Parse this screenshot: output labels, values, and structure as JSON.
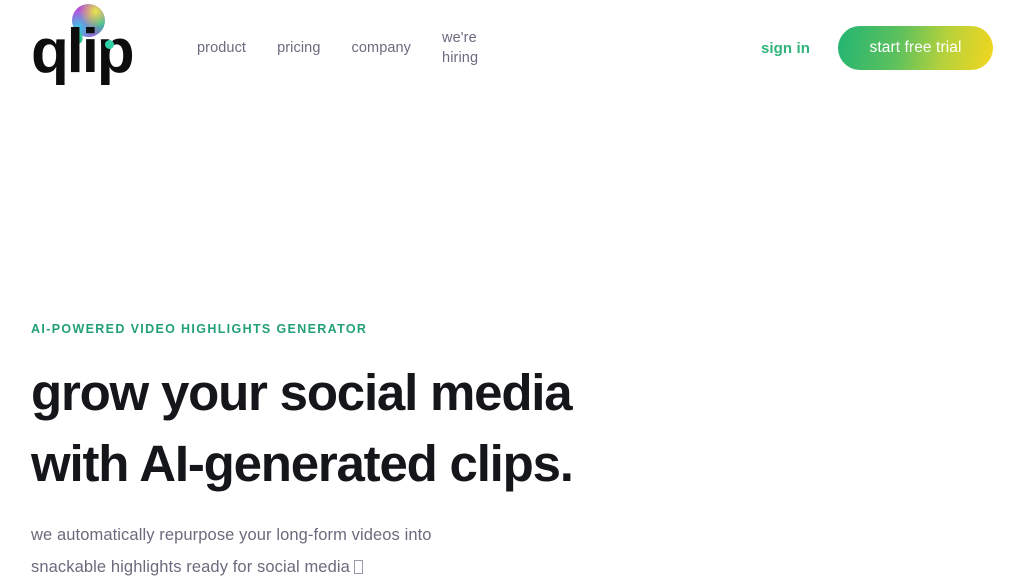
{
  "brand": {
    "wordmark": "qlip",
    "logo_icon": "rainbow-sphere-droplet",
    "accent_teal": "#2fb47c",
    "accent_green_dark": "#22a07a",
    "gradient_start": "#22b573",
    "gradient_end": "#f2d61e"
  },
  "nav": {
    "items": [
      {
        "label": "product"
      },
      {
        "label": "pricing"
      },
      {
        "label": "company"
      }
    ],
    "hiring": {
      "line1": "we're",
      "line2": "hiring"
    }
  },
  "actions": {
    "signin_label": "sign in",
    "cta_label": "start free trial"
  },
  "hero": {
    "eyebrow": "AI-POWERED VIDEO HIGHLIGHTS GENERATOR",
    "headline_line1": "grow your social media",
    "headline_line2": "with AI-generated clips.",
    "subhead_line1": "we automatically repurpose your long-form videos into",
    "subhead_line2": "snackable highlights ready for social media"
  }
}
